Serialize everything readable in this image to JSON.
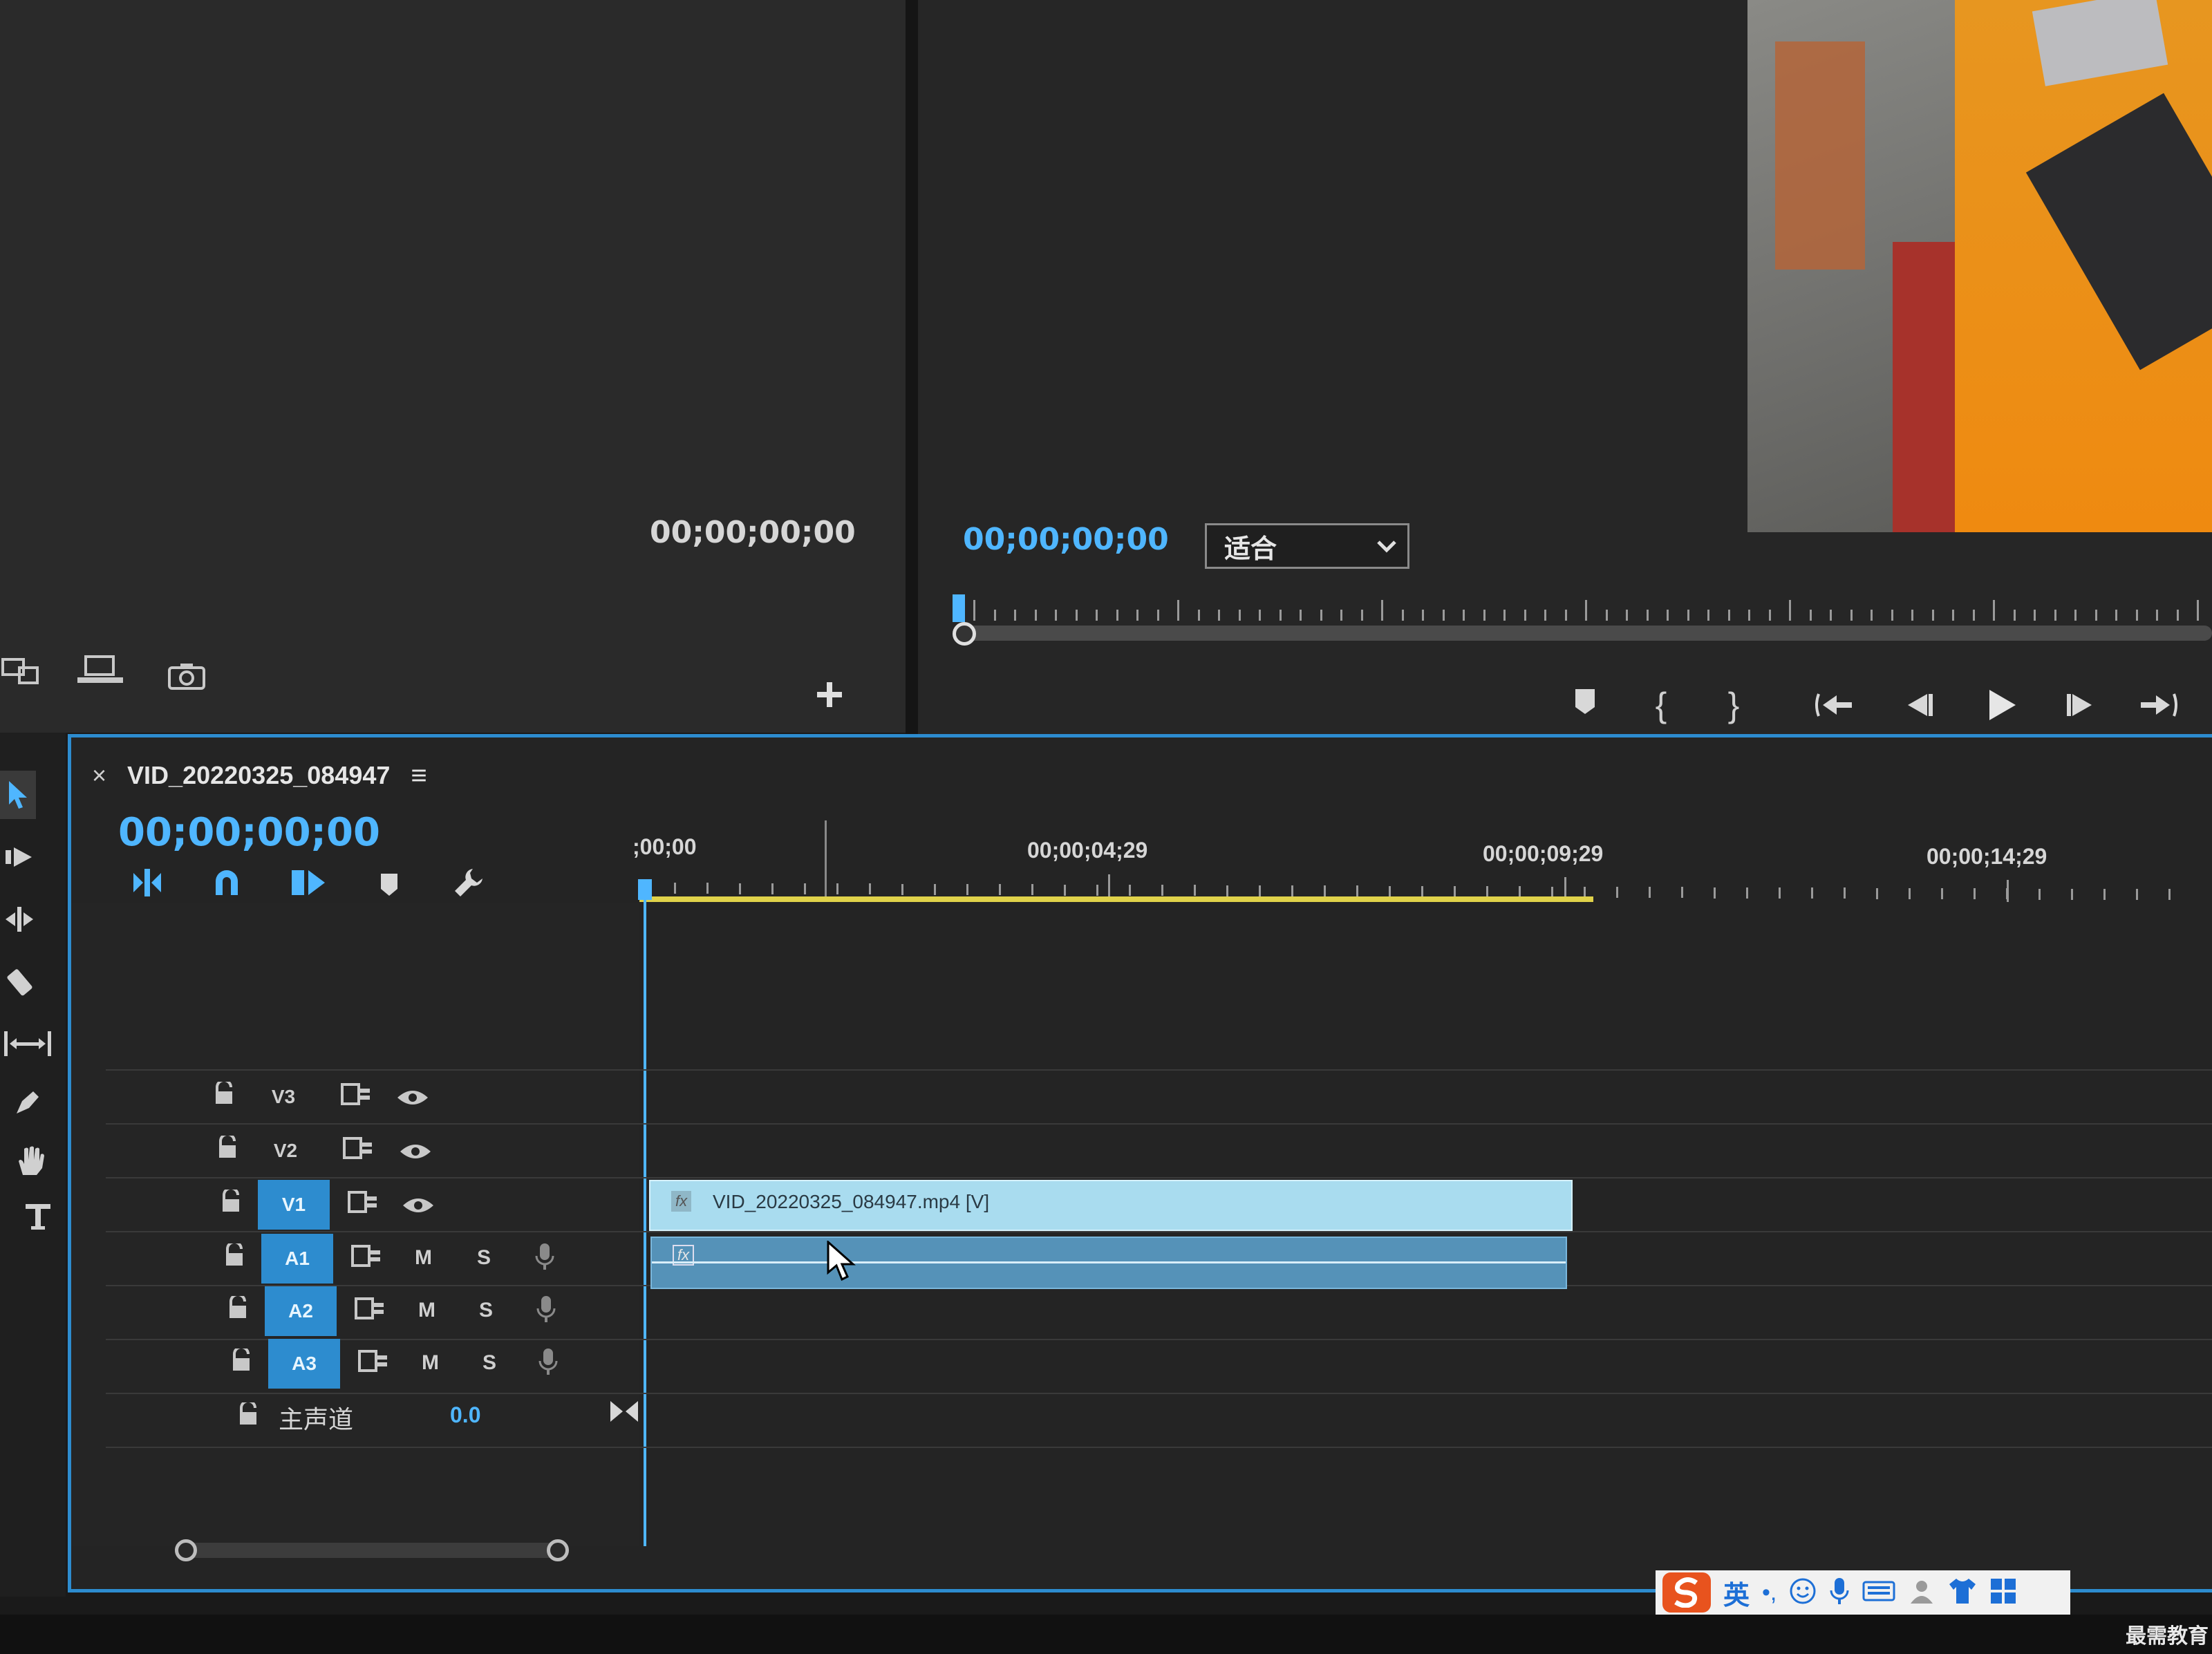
{
  "source_monitor": {
    "timecode": "00;00;00;00"
  },
  "program_monitor": {
    "timecode": "00;00;00;00",
    "zoom_select": "适合"
  },
  "sequence": {
    "name": "VID_20220325_084947",
    "close_glyph": "×",
    "menu_glyph": "≡",
    "timecode": "00;00;00;00",
    "ruler_labels": [
      ";00;00",
      "00;00;04;29",
      "00;00;09;29",
      "00;00;14;29"
    ]
  },
  "tracks": {
    "video": [
      {
        "label": "V3",
        "targeted": false
      },
      {
        "label": "V2",
        "targeted": false
      },
      {
        "label": "V1",
        "targeted": true
      }
    ],
    "audio": [
      {
        "label": "A1",
        "m": "M",
        "s": "S"
      },
      {
        "label": "A2",
        "m": "M",
        "s": "S"
      },
      {
        "label": "A3",
        "m": "M",
        "s": "S"
      }
    ],
    "master": {
      "label": "主声道",
      "value": "0.0"
    }
  },
  "clips": {
    "video_clip_name": "VID_20220325_084947.mp4 [V]",
    "fx": "fx"
  },
  "taskbar": {
    "ime_lang": "英",
    "watermark": "最需教育"
  },
  "colors": {
    "accent": "#2d8ccf",
    "timecode_blue": "#4fb6ff",
    "clip_video": "#a9dcef",
    "clip_audio": "#5592b8",
    "workarea": "#e0d24a"
  }
}
